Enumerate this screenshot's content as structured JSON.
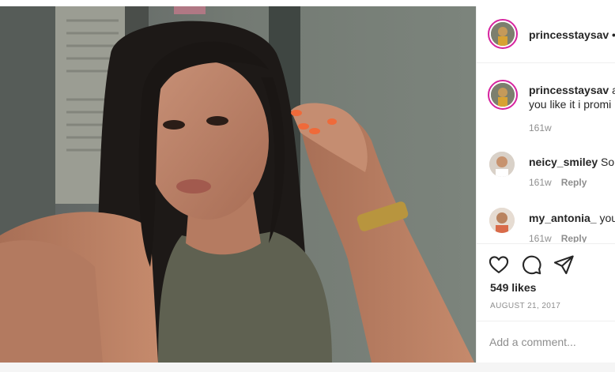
{
  "post": {
    "owner": {
      "username": "princesstaysav",
      "more_glyph": "•"
    },
    "comments": [
      {
        "username": "princesstaysav",
        "text_line1_suffix": " a",
        "text_line2": "you like it i promi",
        "age": "161w",
        "has_reply": false,
        "avatar_icon": "profile-photo"
      },
      {
        "username": "neicy_smiley",
        "text_line1_suffix": " So",
        "age": "161w",
        "reply_label": "Reply",
        "has_reply": true,
        "avatar_icon": "profile-photo"
      },
      {
        "username": "my_antonia_",
        "text_line1_suffix": " you",
        "age": "161w",
        "reply_label": "Reply",
        "has_reply": true,
        "avatar_icon": "profile-photo"
      }
    ],
    "actions": {
      "like_icon": "heart-outline-icon",
      "comment_icon": "speech-bubble-icon",
      "share_icon": "paper-plane-icon"
    },
    "likes_text": "549 likes",
    "date_text": "AUGUST 21, 2017",
    "add_comment_placeholder": "Add a comment..."
  },
  "colors": {
    "text_primary": "#262626",
    "text_secondary": "#8e8e8e",
    "divider": "#efefef",
    "story_ring": "#d6249f"
  }
}
